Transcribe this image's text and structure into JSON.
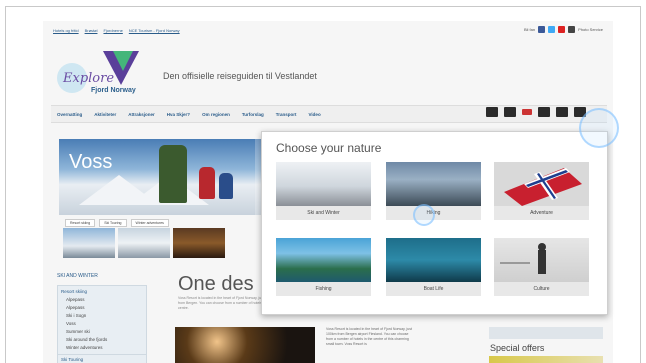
{
  "top_links": [
    "Hotels og fritid",
    "Brøstøl",
    "Fjordnerne",
    "NCE Tourism - Fjord Norway"
  ],
  "utility": {
    "label": "Bli fan",
    "photo_service": "Photo Service"
  },
  "logo": {
    "word1": "Explore",
    "word2": "Fjord Norway"
  },
  "tagline": "Den offisielle reiseguiden til Vestlandet",
  "nav": {
    "items": [
      "Overnatting",
      "Aktiviteter",
      "Attraksjoner",
      "Hva Skjer?",
      "Om regionen",
      "Turforslag",
      "Transport",
      "Video"
    ]
  },
  "hero": {
    "title": "Voss",
    "tabs": [
      "Resort skiing",
      "Ski Touring",
      "Winter adventures"
    ]
  },
  "sidebar": {
    "heading": "SKI AND WINTER",
    "group_label": "Resort skiing",
    "sub_items": [
      "Alpepass",
      "Alpepass",
      "Ski i Sogn",
      "Voss",
      "Summer ski",
      "Ski around the fjords",
      "Winter adventures"
    ],
    "last_item": "Ski Touring"
  },
  "main": {
    "heading": "One des",
    "intro": "Voss Resort is located in the heart of Fjord Norway, just 100km from Bergen. You can choose from a number of hotels in the centre."
  },
  "body_text": "Voss Resort is located in the heart of Fjord Norway, just 100km from Bergen airport Flesland. You can choose from a number of hotels in the centre of this charming small town. Voss Resort is",
  "special_offers": "Special offers",
  "popup": {
    "title": "Choose your nature",
    "tiles": [
      {
        "label": "Ski and Winter",
        "color_top": "#eef1f4",
        "color_bottom": "#8a8f96"
      },
      {
        "label": "Hiking",
        "color_top": "#6f89a6",
        "color_bottom": "#3c4a56"
      },
      {
        "label": "Adventure",
        "color_top": "#d9d9d9",
        "color_bottom": "#bfbfbf"
      },
      {
        "label": "Fishing",
        "color_top": "#4aa3d6",
        "color_bottom": "#2b6e4c"
      },
      {
        "label": "Boat Life",
        "color_top": "#1e6e8a",
        "color_bottom": "#0f3a4a"
      },
      {
        "label": "Culture",
        "color_top": "#e6e6e6",
        "color_bottom": "#cfcfcf"
      }
    ]
  }
}
